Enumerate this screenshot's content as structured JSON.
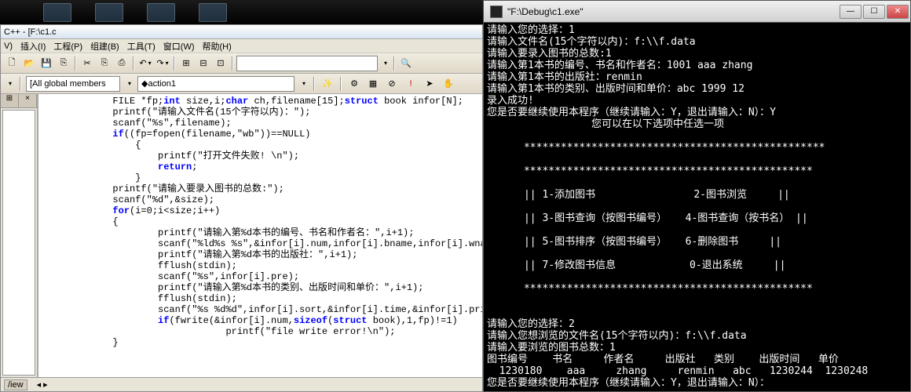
{
  "ide": {
    "title": "C++ - [F:\\c1.c",
    "menu": [
      "V)",
      "插入(I)",
      "工程(P)",
      "组建(B)",
      "工具(T)",
      "窗口(W)",
      "帮助(H)"
    ],
    "combo_global": "[All global members",
    "combo_action": "action1",
    "status_tab": "/iew",
    "code_lines": [
      {
        "indent": 3,
        "segs": [
          {
            "t": "FILE *fp;"
          },
          {
            "t": "int",
            "k": 1
          },
          {
            "t": " size,i;"
          },
          {
            "t": "char",
            "k": 1
          },
          {
            "t": " ch,filename[15];"
          },
          {
            "t": "struct",
            "k": 1
          },
          {
            "t": " book infor[N];"
          }
        ]
      },
      {
        "indent": 3,
        "segs": [
          {
            "t": "printf(\"请输入文件名(15个字符以内)：\");"
          }
        ]
      },
      {
        "indent": 3,
        "segs": [
          {
            "t": "scanf(\"%s\",filename);"
          }
        ]
      },
      {
        "indent": 3,
        "segs": [
          {
            "t": "if",
            "k": 1
          },
          {
            "t": "((fp=fopen(filename,\"wb\"))==NULL)"
          }
        ]
      },
      {
        "indent": 4,
        "segs": [
          {
            "t": "{"
          }
        ]
      },
      {
        "indent": 5,
        "segs": [
          {
            "t": "printf(\"打开文件失败! \\n\");"
          }
        ]
      },
      {
        "indent": 5,
        "segs": [
          {
            "t": "return",
            "k": 1
          },
          {
            "t": ";"
          }
        ]
      },
      {
        "indent": 4,
        "segs": [
          {
            "t": "}"
          }
        ]
      },
      {
        "indent": 3,
        "segs": [
          {
            "t": "printf(\"请输入要录入图书的总数:\");"
          }
        ]
      },
      {
        "indent": 3,
        "segs": [
          {
            "t": "scanf(\"%d\",&size);"
          }
        ]
      },
      {
        "indent": 3,
        "segs": [
          {
            "t": "for",
            "k": 1
          },
          {
            "t": "(i=0;i<size;i++)"
          }
        ]
      },
      {
        "indent": 0,
        "segs": [
          {
            "t": ""
          }
        ]
      },
      {
        "indent": 3,
        "segs": [
          {
            "t": "{"
          }
        ]
      },
      {
        "indent": 5,
        "segs": [
          {
            "t": "printf(\"请输入第%d本书的编号、书名和作者名：\",i+1);"
          }
        ]
      },
      {
        "indent": 5,
        "segs": [
          {
            "t": "scanf(\"%ld%s %s\",&infor[i].num,infor[i].bname,infor[i].wname);"
          }
        ]
      },
      {
        "indent": 5,
        "segs": [
          {
            "t": "printf(\"请输入第%d本书的出版社：\",i+1);"
          }
        ]
      },
      {
        "indent": 5,
        "segs": [
          {
            "t": "fflush(stdin);"
          }
        ]
      },
      {
        "indent": 5,
        "segs": [
          {
            "t": "scanf(\"%s\",infor[i].pre);"
          }
        ]
      },
      {
        "indent": 5,
        "segs": [
          {
            "t": "printf(\"请输入第%d本书的类别、出版时间和单价：\",i+1);"
          }
        ]
      },
      {
        "indent": 5,
        "segs": [
          {
            "t": "fflush(stdin);"
          }
        ]
      },
      {
        "indent": 5,
        "segs": [
          {
            "t": "scanf(\"%s %d%d\",infor[i].sort,&infor[i].time,&infor[i].price);"
          }
        ]
      },
      {
        "indent": 5,
        "segs": [
          {
            "t": "if",
            "k": 1
          },
          {
            "t": "(fwrite(&infor[i].num,"
          },
          {
            "t": "sizeof",
            "k": 1
          },
          {
            "t": "("
          },
          {
            "t": "struct",
            "k": 1
          },
          {
            "t": " book),1,fp)!=1)"
          }
        ]
      },
      {
        "indent": 8,
        "segs": [
          {
            "t": "printf(\"file write error!\\n\");"
          }
        ]
      },
      {
        "indent": 3,
        "segs": [
          {
            "t": "}"
          }
        ]
      }
    ]
  },
  "console": {
    "title": "\"F:\\Debug\\c1.exe\"",
    "lines": [
      "请输入您的选择：1",
      "请输入文件名(15个字符以内)：f:\\\\f.data",
      "请输入要录入图书的总数:1",
      "请输入第1本书的编号、书名和作者名：1001 aaa zhang",
      "请输入第1本书的出版社：renmin",
      "请输入第1本书的类别、出版时间和单价：abc 1999 12",
      "录入成功!",
      "您是否要继续使用本程序（继续请输入：Y，退出请输入：N）：Y",
      "                 您可以在以下选项中任选一项",
      "",
      "      *************************************************",
      "",
      "      ***********************************************",
      "",
      "      || 1-添加图书                2-图书浏览     ||",
      "",
      "      || 3-图书查询（按图书编号）   4-图书查询（按书名） ||",
      "",
      "      || 5-图书排序（按图书编号）   6-删除图书     ||",
      "",
      "      || 7-修改图书信息            0-退出系统     ||",
      "",
      "      ***********************************************",
      "",
      "",
      "请输入您的选择：2",
      "请输入您想浏览的文件名(15个字符以内)：f:\\\\f.data",
      "请输入要浏览的图书总数：1",
      "图书编号    书名     作者名     出版社   类别    出版时间   单价",
      "  1230180    aaa     zhang     renmin   abc   1230244  1230248",
      "您是否要继续使用本程序（继续请输入：Y，退出请输入：N）："
    ]
  }
}
